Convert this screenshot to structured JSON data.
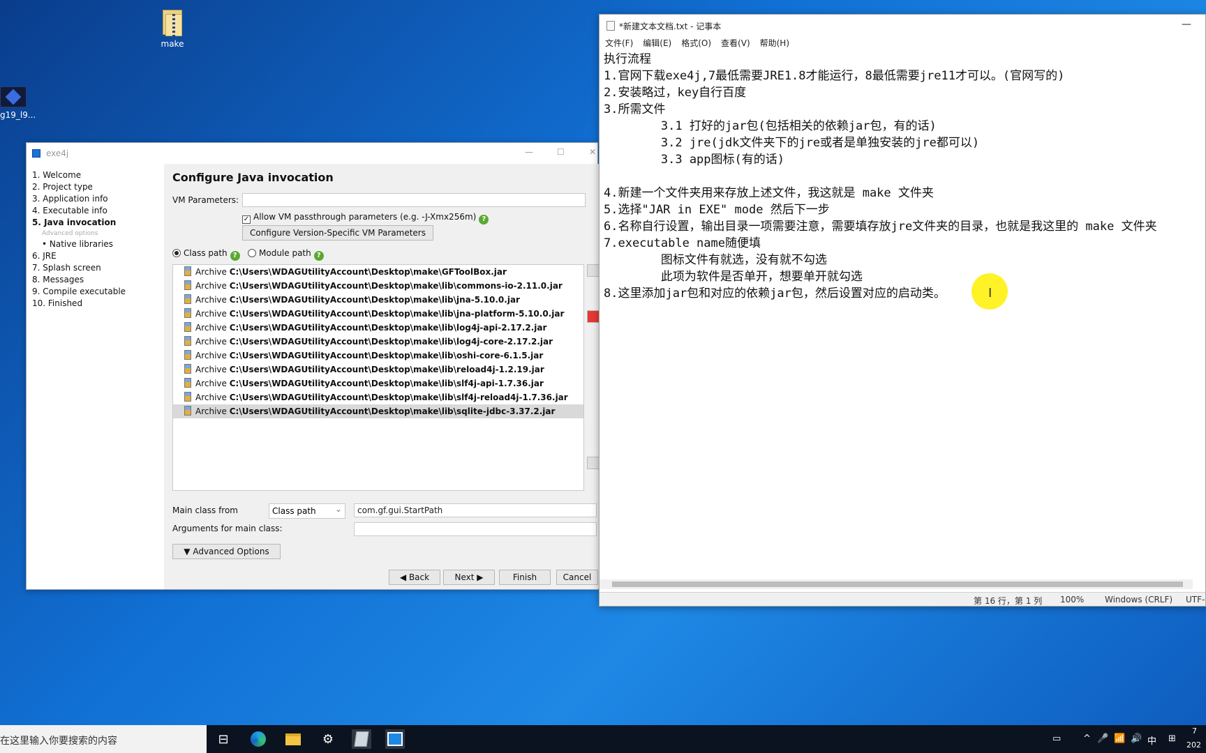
{
  "desktop": {
    "icons": [
      {
        "label": "make"
      },
      {
        "label": "g19_l9..."
      }
    ]
  },
  "exe4j": {
    "title": "exe4j",
    "steps": [
      {
        "label": "1. Welcome"
      },
      {
        "label": "2. Project type"
      },
      {
        "label": "3. Application info"
      },
      {
        "label": "4. Executable info"
      },
      {
        "label": "5. Java invocation"
      },
      {
        "label": "Advanced options"
      },
      {
        "label": "• Native libraries"
      },
      {
        "label": "6. JRE"
      },
      {
        "label": "7. Splash screen"
      },
      {
        "label": "8. Messages"
      },
      {
        "label": "9. Compile executable"
      },
      {
        "label": "10. Finished"
      }
    ],
    "heading": "Configure Java invocation",
    "vm_label": "VM Parameters:",
    "vm_value": "",
    "passthrough_label": "Allow VM passthrough parameters (e.g. -J-Xmx256m)",
    "version_btn": "Configure Version-Specific VM Parameters",
    "classpath_label": "Class path",
    "modulepath_label": "Module path",
    "archive_prefix": "Archive",
    "archives": [
      "C:\\Users\\WDAGUtilityAccount\\Desktop\\make\\GFToolBox.jar",
      "C:\\Users\\WDAGUtilityAccount\\Desktop\\make\\lib\\commons-io-2.11.0.jar",
      "C:\\Users\\WDAGUtilityAccount\\Desktop\\make\\lib\\jna-5.10.0.jar",
      "C:\\Users\\WDAGUtilityAccount\\Desktop\\make\\lib\\jna-platform-5.10.0.jar",
      "C:\\Users\\WDAGUtilityAccount\\Desktop\\make\\lib\\log4j-api-2.17.2.jar",
      "C:\\Users\\WDAGUtilityAccount\\Desktop\\make\\lib\\log4j-core-2.17.2.jar",
      "C:\\Users\\WDAGUtilityAccount\\Desktop\\make\\lib\\oshi-core-6.1.5.jar",
      "C:\\Users\\WDAGUtilityAccount\\Desktop\\make\\lib\\reload4j-1.2.19.jar",
      "C:\\Users\\WDAGUtilityAccount\\Desktop\\make\\lib\\slf4j-api-1.7.36.jar",
      "C:\\Users\\WDAGUtilityAccount\\Desktop\\make\\lib\\slf4j-reload4j-1.7.36.jar",
      "C:\\Users\\WDAGUtilityAccount\\Desktop\\make\\lib\\sqlite-jdbc-3.37.2.jar"
    ],
    "mainclass_label": "Main class from",
    "mainclass_source": "Class path",
    "mainclass_value": "com.gf.gui.StartPath",
    "browse": "...",
    "args_label": "Arguments for main class:",
    "args_value": "",
    "advanced_btn": "Advanced Options",
    "back_btn": "Back",
    "next_btn": "Next",
    "finish_btn": "Finish",
    "cancel_btn": "Cancel"
  },
  "notepad": {
    "title": "*新建文本文档.txt - 记事本",
    "menu": [
      "文件(F)",
      "编辑(E)",
      "格式(O)",
      "查看(V)",
      "帮助(H)"
    ],
    "lines": [
      "执行流程",
      "1.官网下载exe4j,7最低需要JRE1.8才能运行，8最低需要jre11才可以。(官网写的)",
      "2.安装略过，key自行百度",
      "3.所需文件",
      "        3.1 打好的jar包(包括相关的依赖jar包，有的话)",
      "        3.2 jre(jdk文件夹下的jre或者是单独安装的jre都可以)",
      "        3.3 app图标(有的话)",
      "",
      "4.新建一个文件夹用来存放上述文件，我这就是 make 文件夹",
      "5.选择\"JAR in EXE\" mode 然后下一步",
      "6.名称自行设置，输出目录一项需要注意，需要填存放jre文件夹的目录，也就是我这里的 make 文件夹",
      "7.executable name随便填",
      "        图标文件有就选，没有就不勾选",
      "        此项为软件是否单开，想要单开就勾选",
      "8.这里添加jar包和对应的依赖jar包，然后设置对应的启动类。",
      ""
    ],
    "status_pos": "第 16 行，第 1 列",
    "status_zoom": "100%",
    "status_eol": "Windows (CRLF)",
    "status_enc": "UTF-"
  },
  "taskbar": {
    "search_placeholder": "在这里输入你要搜索的内容",
    "tray_icons": [
      "^",
      "🎤",
      "📶",
      "🔊",
      "中",
      "⊞"
    ],
    "time": "7",
    "date": "202"
  }
}
